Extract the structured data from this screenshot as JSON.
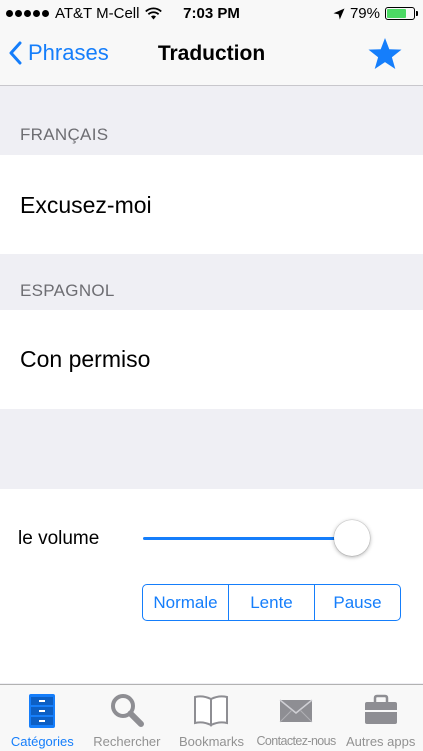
{
  "status_bar": {
    "carrier": "AT&T M-Cell",
    "time": "7:03 PM",
    "battery_percent": "79%",
    "battery_level": 0.79
  },
  "nav": {
    "back_label": "Phrases",
    "title": "Traduction",
    "star_icon": "star-icon",
    "accent_color": "#157efb"
  },
  "source": {
    "header": "FRANÇAIS",
    "phrase": "Excusez-moi"
  },
  "target": {
    "header": "ESPAGNOL",
    "phrase": "Con permiso"
  },
  "audio": {
    "volume_label": "le volume",
    "volume_level": 0.9,
    "speeds": [
      "Normale",
      "Lente",
      "Pause"
    ]
  },
  "tabs": [
    {
      "label": "Catégories",
      "icon": "drawer-icon",
      "active": true
    },
    {
      "label": "Rechercher",
      "icon": "search-icon",
      "active": false
    },
    {
      "label": "Bookmarks",
      "icon": "book-icon",
      "active": false
    },
    {
      "label": "Contactez-nous",
      "icon": "envelope-icon",
      "active": false
    },
    {
      "label": "Autres apps",
      "icon": "briefcase-icon",
      "active": false
    }
  ]
}
